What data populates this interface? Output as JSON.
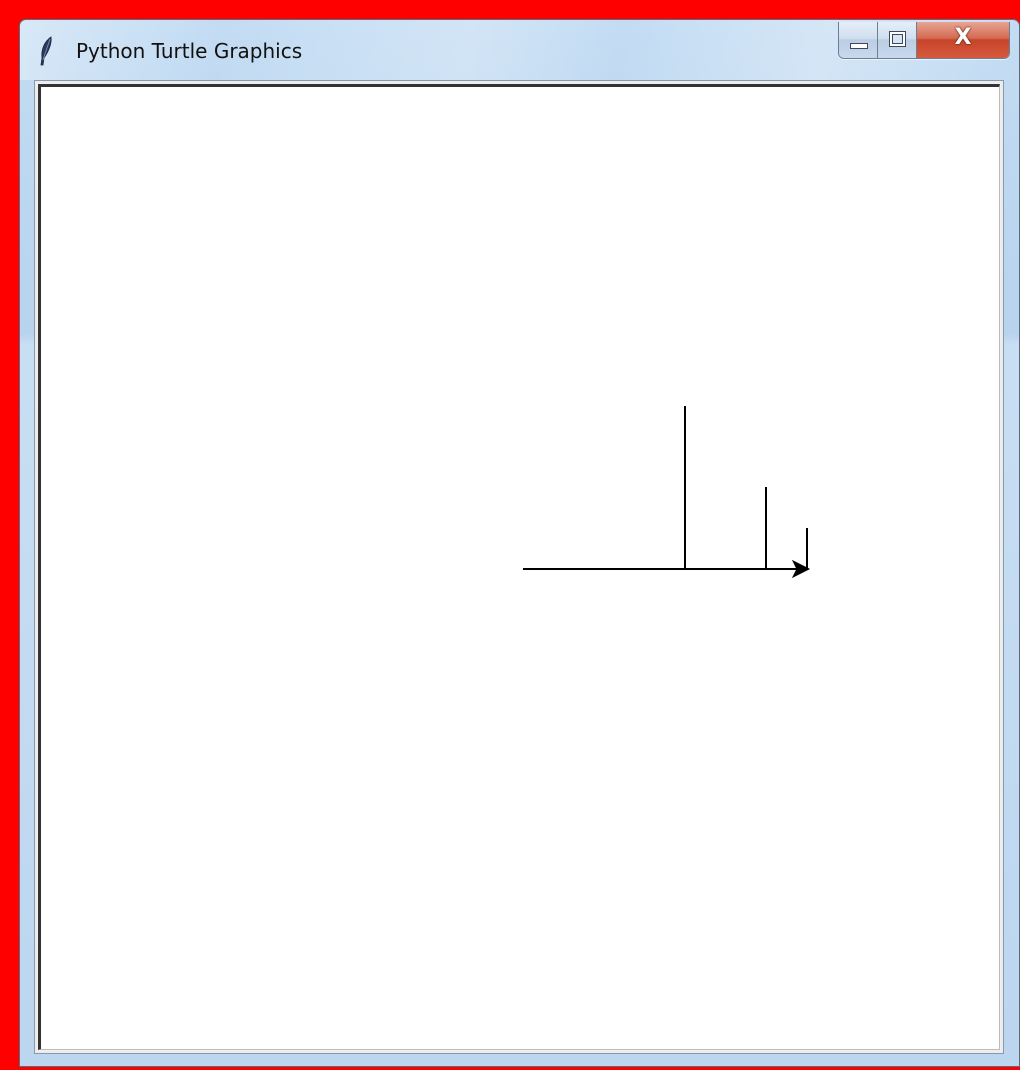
{
  "window": {
    "title": "Python Turtle Graphics",
    "app_icon": "feather-icon",
    "controls": {
      "minimize_icon": "minimize-icon",
      "maximize_icon": "maximize-icon",
      "close_icon": "close-icon",
      "close_label": "X"
    }
  },
  "colors": {
    "desktop_background": "#ff0000",
    "canvas_background": "#ffffff",
    "pen_color": "#000000"
  },
  "canvas": {
    "turtle_shape": "arrow",
    "turtle_heading": "east"
  }
}
